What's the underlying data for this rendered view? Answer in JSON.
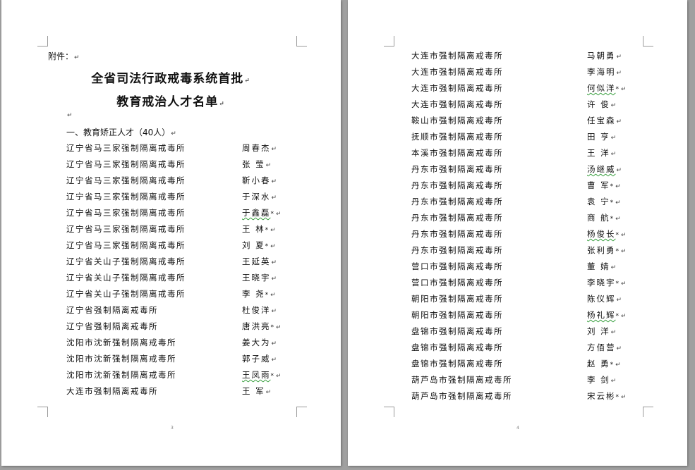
{
  "left_page": {
    "attachment_label": "附件：",
    "title_line1": "全省司法行政戒毒系统首批",
    "title_line2": "教育戒治人才名单",
    "section_heading": "一、教育矫正人才（40人）",
    "rows": [
      {
        "unit": "辽宁省马三家强制隔离戒毒所",
        "name": "周春杰",
        "mark": ""
      },
      {
        "unit": "辽宁省马三家强制隔离戒毒所",
        "name": "张 莹",
        "mark": ""
      },
      {
        "unit": "辽宁省马三家强制隔离戒毒所",
        "name": "靳小春",
        "mark": ""
      },
      {
        "unit": "辽宁省马三家强制隔离戒毒所",
        "name": "于深水",
        "mark": ""
      },
      {
        "unit": "辽宁省马三家强制隔离戒毒所",
        "name": "于鑫磊",
        "mark": "*"
      },
      {
        "unit": "辽宁省马三家强制隔离戒毒所",
        "name": "王 林",
        "mark": "*"
      },
      {
        "unit": "辽宁省马三家强制隔离戒毒所",
        "name": "刘 夏",
        "mark": "*"
      },
      {
        "unit": "辽宁省关山子强制隔离戒毒所",
        "name": "王延英",
        "mark": ""
      },
      {
        "unit": "辽宁省关山子强制隔离戒毒所",
        "name": "王晓宇",
        "mark": ""
      },
      {
        "unit": "辽宁省关山子强制隔离戒毒所",
        "name": "李 尧",
        "mark": "*"
      },
      {
        "unit": "辽宁省强制隔离戒毒所",
        "name": "杜俊洋",
        "mark": ""
      },
      {
        "unit": "辽宁省强制隔离戒毒所",
        "name": "唐洪亮",
        "mark": "*"
      },
      {
        "unit": "沈阳市沈新强制隔离戒毒所",
        "name": "姜大为",
        "mark": ""
      },
      {
        "unit": "沈阳市沈新强制隔离戒毒所",
        "name": "郭子威",
        "mark": ""
      },
      {
        "unit": "沈阳市沈新强制隔离戒毒所",
        "name": "王凤雨",
        "mark": "*"
      },
      {
        "unit": "大连市强制隔离戒毒所",
        "name": "王 军",
        "mark": ""
      }
    ],
    "page_number": "3"
  },
  "right_page": {
    "rows": [
      {
        "unit": "大连市强制隔离戒毒所",
        "name": "马朝勇",
        "mark": ""
      },
      {
        "unit": "大连市强制隔离戒毒所",
        "name": "李海明",
        "mark": ""
      },
      {
        "unit": "大连市强制隔离戒毒所",
        "name": "何似洋",
        "mark": "*"
      },
      {
        "unit": "大连市强制隔离戒毒所",
        "name": "许 俊",
        "mark": ""
      },
      {
        "unit": "鞍山市强制隔离戒毒所",
        "name": "任宝森",
        "mark": ""
      },
      {
        "unit": "抚顺市强制隔离戒毒所",
        "name": "田 亨",
        "mark": ""
      },
      {
        "unit": "本溪市强制隔离戒毒所",
        "name": "王 洋",
        "mark": ""
      },
      {
        "unit": "丹东市强制隔离戒毒所",
        "name": "汤继威",
        "mark": ""
      },
      {
        "unit": "丹东市强制隔离戒毒所",
        "name": "曹 军",
        "mark": "*"
      },
      {
        "unit": "丹东市强制隔离戒毒所",
        "name": "袁 宁",
        "mark": "*"
      },
      {
        "unit": "丹东市强制隔离戒毒所",
        "name": "商 航",
        "mark": "*"
      },
      {
        "unit": "丹东市强制隔离戒毒所",
        "name": "杨俊长",
        "mark": "*"
      },
      {
        "unit": "丹东市强制隔离戒毒所",
        "name": "张利勇",
        "mark": "*"
      },
      {
        "unit": "营口市强制隔离戒毒所",
        "name": "董 婧",
        "mark": ""
      },
      {
        "unit": "营口市强制隔离戒毒所",
        "name": "李晓宇",
        "mark": "*"
      },
      {
        "unit": "朝阳市强制隔离戒毒所",
        "name": "陈仪辉",
        "mark": ""
      },
      {
        "unit": "朝阳市强制隔离戒毒所",
        "name": "杨礼辉",
        "mark": "*"
      },
      {
        "unit": "盘锦市强制隔离戒毒所",
        "name": "刘 洋",
        "mark": ""
      },
      {
        "unit": "盘锦市强制隔离戒毒所",
        "name": "方佰营",
        "mark": ""
      },
      {
        "unit": "盘锦市强制隔离戒毒所",
        "name": "赵 勇",
        "mark": "*"
      },
      {
        "unit": "葫芦岛市强制隔离戒毒所",
        "name": "李 剑",
        "mark": ""
      },
      {
        "unit": "葫芦岛市强制隔离戒毒所",
        "name": "宋云彬",
        "mark": "*"
      }
    ],
    "page_number": "4"
  },
  "paragraph_mark": "↵"
}
